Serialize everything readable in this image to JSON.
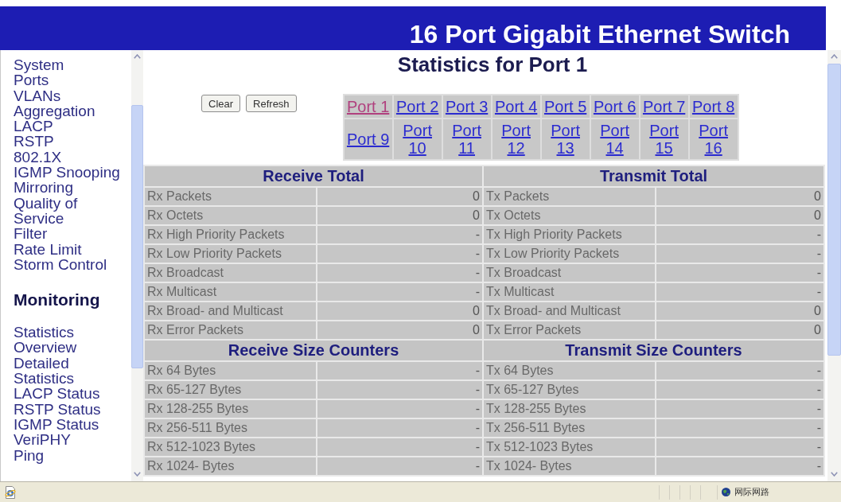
{
  "window": {
    "title": "16 Port Gigabit Ethernet Switch"
  },
  "sidebar": {
    "sections": [
      {
        "items": [
          "System",
          "Ports",
          "VLANs",
          "Aggregation",
          "LACP",
          "RSTP",
          "802.1X",
          "IGMP Snooping",
          "Mirroring",
          "Quality of Service",
          "Filter",
          "Rate Limit",
          "Storm Control"
        ]
      },
      {
        "heading": "Monitoring",
        "items": [
          "Statistics Overview",
          "Detailed Statistics",
          "LACP Status",
          "RSTP Status",
          "IGMP Status",
          "VeriPHY",
          "Ping"
        ]
      }
    ]
  },
  "page": {
    "heading": "Statistics for Port 1",
    "buttons": [
      "Clear",
      "Refresh"
    ],
    "ports": [
      {
        "label": "Port 1",
        "selected": true
      },
      {
        "label": "Port 2",
        "selected": false
      },
      {
        "label": "Port 3",
        "selected": false
      },
      {
        "label": "Port 4",
        "selected": false
      },
      {
        "label": "Port 5",
        "selected": false
      },
      {
        "label": "Port 6",
        "selected": false
      },
      {
        "label": "Port 7",
        "selected": false
      },
      {
        "label": "Port 8",
        "selected": false
      },
      {
        "label": "Port 9",
        "selected": false
      },
      {
        "label": "Port 10",
        "selected": false
      },
      {
        "label": "Port 11",
        "selected": false
      },
      {
        "label": "Port 12",
        "selected": false
      },
      {
        "label": "Port 13",
        "selected": false
      },
      {
        "label": "Port 14",
        "selected": false
      },
      {
        "label": "Port 15",
        "selected": false
      },
      {
        "label": "Port 16",
        "selected": false
      }
    ]
  },
  "statistics": {
    "sections": [
      {
        "rx_title": "Receive Total",
        "tx_title": "Transmit Total",
        "rows": [
          {
            "rx_label": "Rx Packets",
            "rx_value": "0",
            "tx_label": "Tx Packets",
            "tx_value": "0"
          },
          {
            "rx_label": "Rx Octets",
            "rx_value": "0",
            "tx_label": "Tx Octets",
            "tx_value": "0"
          },
          {
            "rx_label": "Rx High Priority Packets",
            "rx_value": "-",
            "tx_label": "Tx High Priority Packets",
            "tx_value": "-"
          },
          {
            "rx_label": "Rx Low Priority Packets",
            "rx_value": "-",
            "tx_label": "Tx Low Priority Packets",
            "tx_value": "-"
          },
          {
            "rx_label": "Rx Broadcast",
            "rx_value": "-",
            "tx_label": "Tx Broadcast",
            "tx_value": "-"
          },
          {
            "rx_label": "Rx Multicast",
            "rx_value": "-",
            "tx_label": "Tx Multicast",
            "tx_value": "-"
          },
          {
            "rx_label": "Rx Broad- and Multicast",
            "rx_value": "0",
            "tx_label": "Tx Broad- and Multicast",
            "tx_value": "0"
          },
          {
            "rx_label": "Rx Error Packets",
            "rx_value": "0",
            "tx_label": "Tx Error Packets",
            "tx_value": "0"
          }
        ]
      },
      {
        "rx_title": "Receive Size Counters",
        "tx_title": "Transmit Size Counters",
        "rows": [
          {
            "rx_label": "Rx 64 Bytes",
            "rx_value": "-",
            "tx_label": "Tx 64 Bytes",
            "tx_value": "-"
          },
          {
            "rx_label": "Rx 65-127 Bytes",
            "rx_value": "-",
            "tx_label": "Tx 65-127 Bytes",
            "tx_value": "-"
          },
          {
            "rx_label": "Rx 128-255 Bytes",
            "rx_value": "-",
            "tx_label": "Tx 128-255 Bytes",
            "tx_value": "-"
          },
          {
            "rx_label": "Rx 256-511 Bytes",
            "rx_value": "-",
            "tx_label": "Tx 256-511 Bytes",
            "tx_value": "-"
          },
          {
            "rx_label": "Rx 512-1023 Bytes",
            "rx_value": "-",
            "tx_label": "Tx 512-1023 Bytes",
            "tx_value": "-"
          },
          {
            "rx_label": "Rx 1024- Bytes",
            "rx_value": "-",
            "tx_label": "Tx 1024- Bytes",
            "tx_value": "-"
          }
        ]
      }
    ]
  },
  "status_bar": {
    "zone": "网际网路"
  }
}
